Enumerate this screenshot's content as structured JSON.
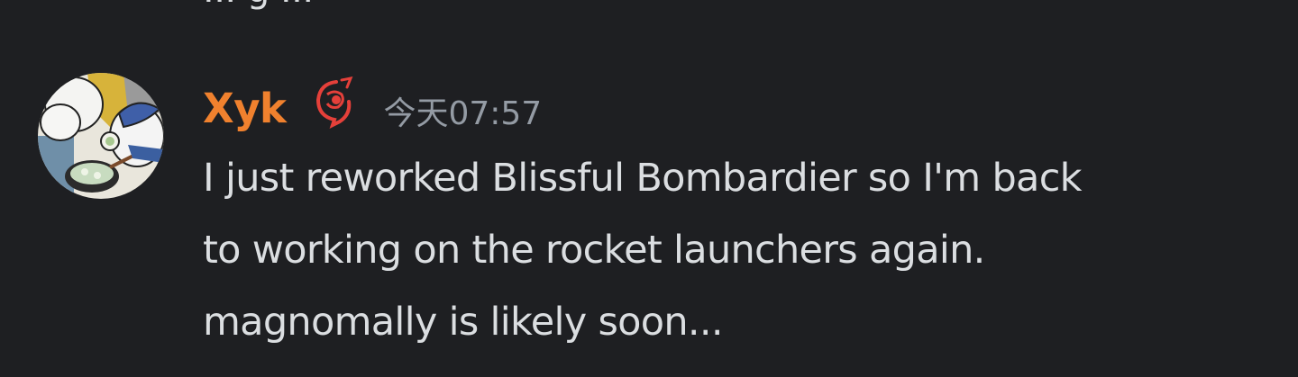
{
  "previous_message": {
    "text": "... g ..."
  },
  "message": {
    "author": {
      "name": "Xyk",
      "name_color": "#f0812e",
      "role_icon": "role-badge-icon"
    },
    "timestamp": "今天07:57",
    "lines": [
      "I just reworked Blissful Bombardier so I'm back",
      "to working on the rocket launchers again.",
      "magnomally is likely soon..."
    ]
  },
  "colors": {
    "background": "#1e1f22",
    "text": "#dbdee1",
    "muted": "#949ba4",
    "role_icon": "#e5403a"
  }
}
